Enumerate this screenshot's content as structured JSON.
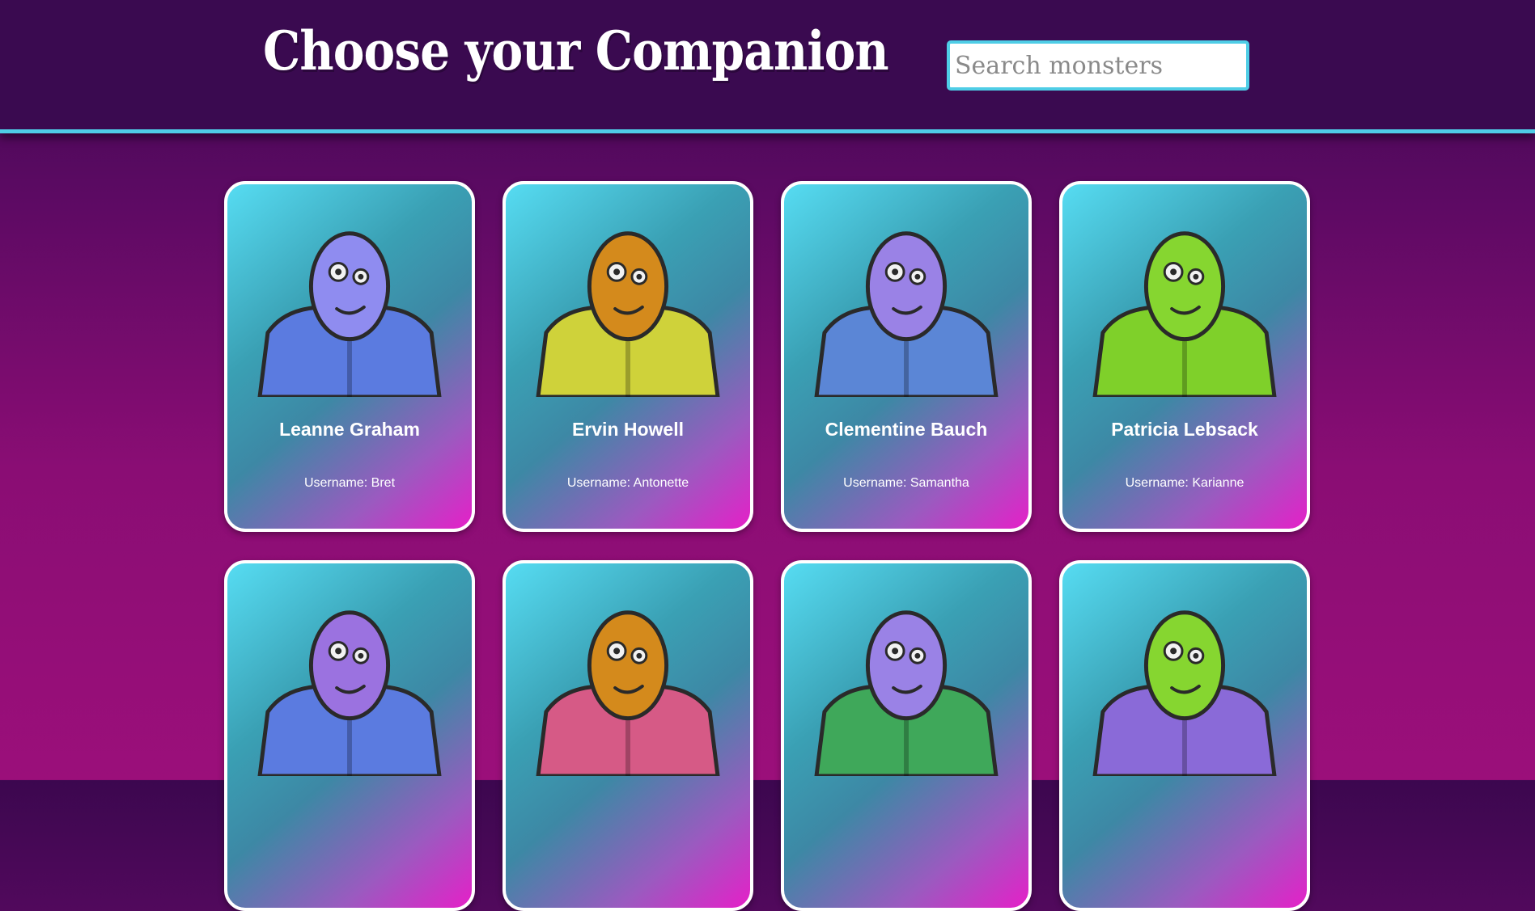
{
  "header": {
    "title": "Choose your Companion",
    "search_placeholder": "Search monsters"
  },
  "cards": [
    {
      "name": "Leanne Graham",
      "username": "Username: Bret",
      "body_color": "#5b7be0",
      "head_color": "#8f8cf0"
    },
    {
      "name": "Ervin Howell",
      "username": "Username: Antonette",
      "body_color": "#cfd23a",
      "head_color": "#d48a1c"
    },
    {
      "name": "Clementine Bauch",
      "username": "Username: Samantha",
      "body_color": "#5b86d6",
      "head_color": "#9a82e6"
    },
    {
      "name": "Patricia Lebsack",
      "username": "Username: Karianne",
      "body_color": "#7fd02a",
      "head_color": "#86d630"
    },
    {
      "name": "",
      "username": "",
      "body_color": "#5b7be0",
      "head_color": "#9b72e0"
    },
    {
      "name": "",
      "username": "",
      "body_color": "#d65a86",
      "head_color": "#d48a1c"
    },
    {
      "name": "",
      "username": "",
      "body_color": "#3fa85a",
      "head_color": "#9a82e6"
    },
    {
      "name": "",
      "username": "",
      "body_color": "#8a6ad8",
      "head_color": "#86d630"
    }
  ]
}
